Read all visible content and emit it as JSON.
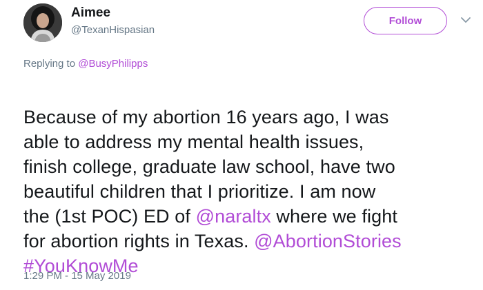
{
  "colors": {
    "accent": "#b14cd6",
    "text": "#14171a",
    "muted": "#657786"
  },
  "author": {
    "display_name": "Aimee",
    "handle": "@TexanHispasian",
    "avatar_icon": "profile-photo"
  },
  "header": {
    "follow_label": "Follow",
    "menu_icon": "chevron-down-icon"
  },
  "reply": {
    "prefix": "Replying to ",
    "mention": "@BusyPhilipps"
  },
  "tweet": {
    "segments": [
      {
        "text": "Because of my abortion 16 years ago, I was\nable to address my mental health issues,\nfinish college, graduate law school, have two\nbeautiful children that I  prioritize. I am now\nthe (1st POC) ED of ",
        "link": false
      },
      {
        "text": "@naraltx",
        "link": true
      },
      {
        "text": " where we fight\nfor abortion rights in Texas. ",
        "link": false
      },
      {
        "text": "@AbortionStories",
        "link": true
      },
      {
        "text": "\n",
        "link": false
      },
      {
        "text": "#YouKnowMe",
        "link": true
      }
    ]
  },
  "timestamp": "1:29 PM - 15 May 2019"
}
